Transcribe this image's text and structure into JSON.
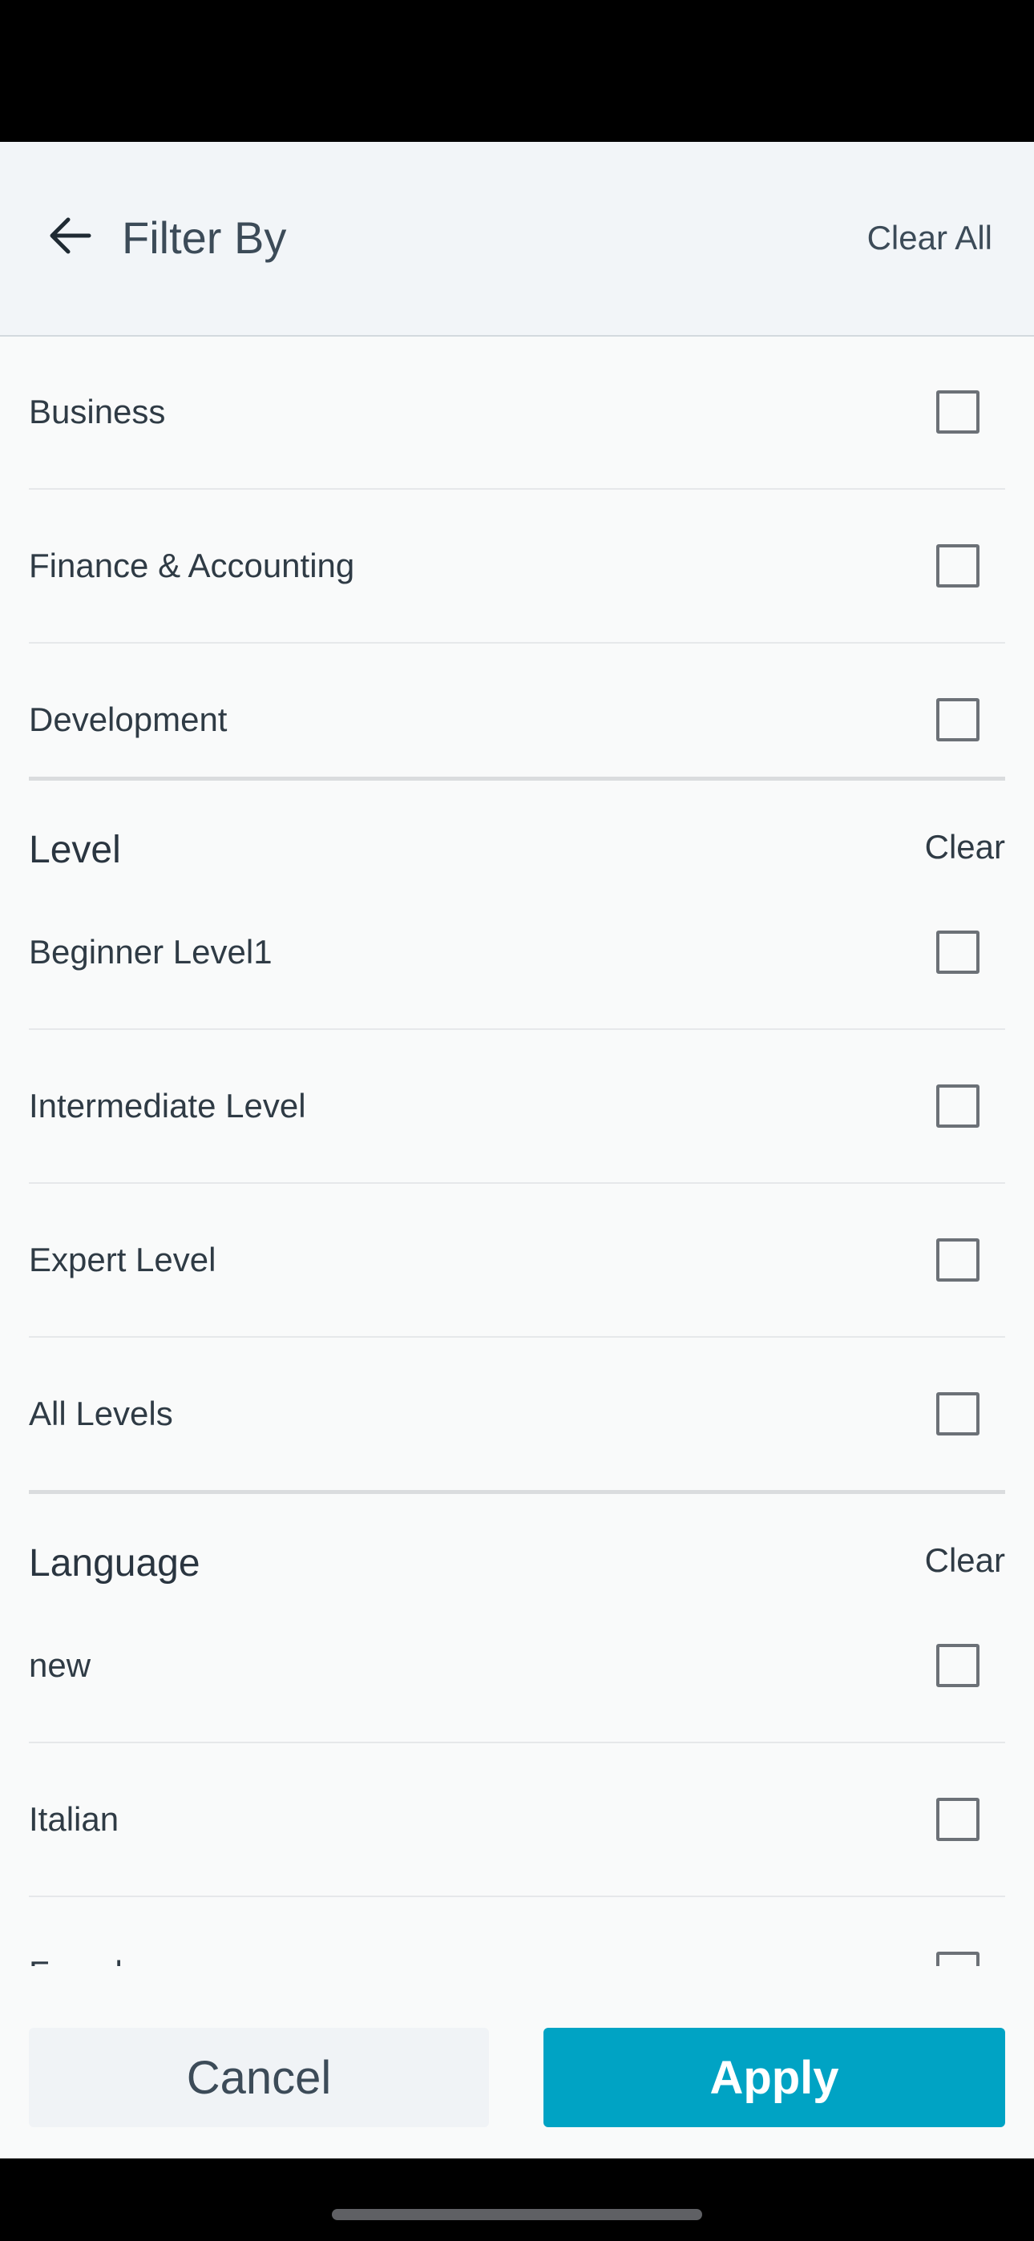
{
  "header": {
    "title": "Filter By",
    "clear_all_label": "Clear All",
    "back_icon": "arrow-left-icon"
  },
  "category_items": [
    {
      "label": "Business",
      "checked": false
    },
    {
      "label": "Finance & Accounting",
      "checked": false
    },
    {
      "label": "Development",
      "checked": false
    }
  ],
  "level_section": {
    "title": "Level",
    "clear_label": "Clear",
    "items": [
      {
        "label": "Beginner Level1",
        "checked": false
      },
      {
        "label": "Intermediate Level",
        "checked": false
      },
      {
        "label": "Expert Level",
        "checked": false
      },
      {
        "label": "All Levels",
        "checked": false
      }
    ]
  },
  "language_section": {
    "title": "Language",
    "clear_label": "Clear",
    "items": [
      {
        "label": "new",
        "checked": false
      },
      {
        "label": "Italian",
        "checked": false
      },
      {
        "label": "French",
        "checked": false
      }
    ]
  },
  "footer": {
    "cancel_label": "Cancel",
    "apply_label": "Apply"
  },
  "colors": {
    "accent": "#00a3c4",
    "header_bg": "#f2f5f8",
    "text": "#2f3b45"
  }
}
